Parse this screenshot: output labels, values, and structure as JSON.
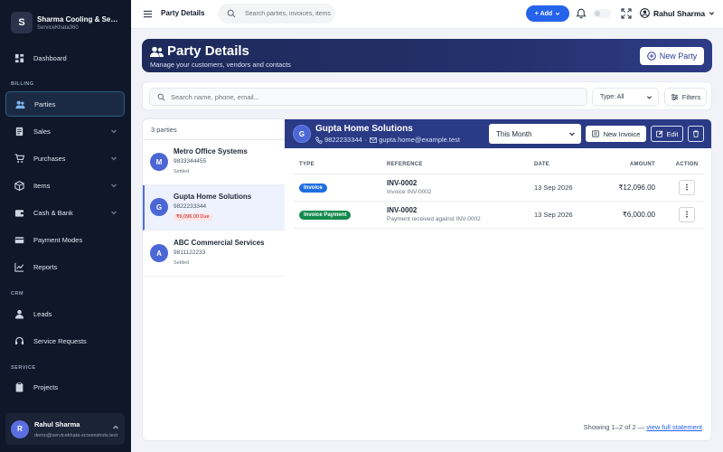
{
  "brand": {
    "logo_letter": "S",
    "name": "Sharma Cooling & Services",
    "subtitle": "ServiceKhata360"
  },
  "sidebar": {
    "sections": {
      "billing": "BILLING",
      "crm": "CRM",
      "service": "SERVICE"
    },
    "items": [
      {
        "label": "Dashboard",
        "icon": "dashboard-icon"
      },
      {
        "label": "Parties",
        "icon": "users-icon",
        "active": true
      },
      {
        "label": "Sales",
        "icon": "sales-icon"
      },
      {
        "label": "Purchases",
        "icon": "cart-icon"
      },
      {
        "label": "Items",
        "icon": "box-icon"
      },
      {
        "label": "Cash & Bank",
        "icon": "wallet-icon"
      },
      {
        "label": "Payment Modes",
        "icon": "card-icon"
      },
      {
        "label": "Reports",
        "icon": "chart-icon"
      },
      {
        "label": "Leads",
        "icon": "leads-icon"
      },
      {
        "label": "Service Requests",
        "icon": "headset-icon"
      },
      {
        "label": "Projects",
        "icon": "clipboard-icon"
      }
    ],
    "user": {
      "initial": "R",
      "name": "Rahul Sharma",
      "email": "demo@servicekhata-screenshots.test"
    }
  },
  "topbar": {
    "title": "Party Details",
    "search_placeholder": "Search parties, invoices, items...",
    "add_label": "+ Add",
    "user_name": "Rahul Sharma"
  },
  "hero": {
    "title": "Party Details",
    "subtitle": "Manage your customers, vendors and contacts",
    "new_party_label": "New Party"
  },
  "filters": {
    "search_placeholder": "Search name, phone, email...",
    "type_label": "Type: All",
    "filters_label": "Filters"
  },
  "party_list": {
    "count_text": "3 parties",
    "parties": [
      {
        "initial": "M",
        "name": "Metro Office Systems",
        "phone": "9833344455",
        "status": "Settled"
      },
      {
        "initial": "G",
        "name": "Gupta Home Solutions",
        "phone": "9822233344",
        "due": "₹6,096.00 Due",
        "active": true
      },
      {
        "initial": "A",
        "name": "ABC Commercial Services",
        "phone": "9811122233",
        "status": "Settled"
      }
    ]
  },
  "detail": {
    "initial": "G",
    "name": "Gupta Home Solutions",
    "phone": "9822233344",
    "separator": "·",
    "email": "gupta.home@example.test",
    "period": "This Month",
    "new_invoice_label": "New Invoice",
    "edit_label": "Edit",
    "columns": {
      "type": "TYPE",
      "reference": "REFERENCE",
      "date": "DATE",
      "amount": "AMOUNT",
      "action": "ACTION"
    },
    "rows": [
      {
        "type": "Invoice",
        "type_color": "#1d6fe0",
        "ref": "INV-0002",
        "ref_sub": "Invoice INV-0002",
        "date": "13 Sep 2026",
        "amount": "₹12,096.00"
      },
      {
        "type": "Invoice Payment",
        "type_color": "#138a4c",
        "ref": "INV-0002",
        "ref_sub": "Payment received against INV-0002",
        "date": "13 Sep 2026",
        "amount": "₹6,000.00"
      }
    ],
    "footer_text": "Showing 1–2 of 2 —",
    "footer_link": "view full statement"
  }
}
